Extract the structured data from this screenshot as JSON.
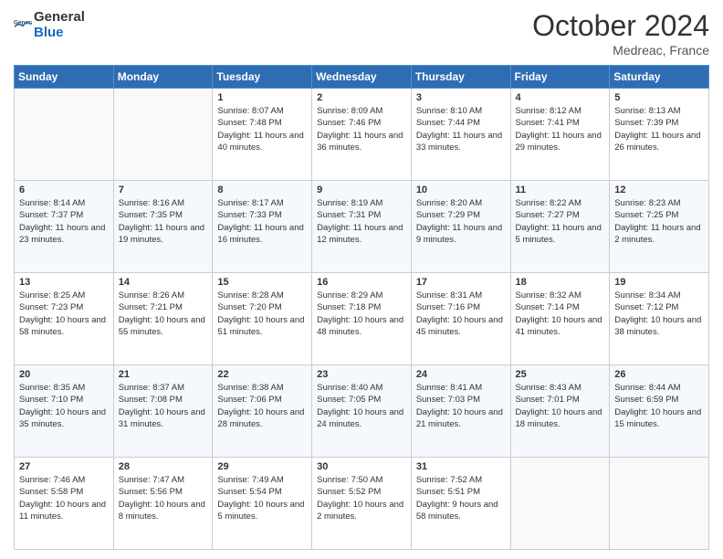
{
  "header": {
    "logo_general": "General",
    "logo_blue": "Blue",
    "title": "October 2024",
    "location": "Medreac, France"
  },
  "columns": [
    "Sunday",
    "Monday",
    "Tuesday",
    "Wednesday",
    "Thursday",
    "Friday",
    "Saturday"
  ],
  "weeks": [
    [
      {
        "day": "",
        "info": ""
      },
      {
        "day": "",
        "info": ""
      },
      {
        "day": "1",
        "info": "Sunrise: 8:07 AM\nSunset: 7:48 PM\nDaylight: 11 hours and 40 minutes."
      },
      {
        "day": "2",
        "info": "Sunrise: 8:09 AM\nSunset: 7:46 PM\nDaylight: 11 hours and 36 minutes."
      },
      {
        "day": "3",
        "info": "Sunrise: 8:10 AM\nSunset: 7:44 PM\nDaylight: 11 hours and 33 minutes."
      },
      {
        "day": "4",
        "info": "Sunrise: 8:12 AM\nSunset: 7:41 PM\nDaylight: 11 hours and 29 minutes."
      },
      {
        "day": "5",
        "info": "Sunrise: 8:13 AM\nSunset: 7:39 PM\nDaylight: 11 hours and 26 minutes."
      }
    ],
    [
      {
        "day": "6",
        "info": "Sunrise: 8:14 AM\nSunset: 7:37 PM\nDaylight: 11 hours and 23 minutes."
      },
      {
        "day": "7",
        "info": "Sunrise: 8:16 AM\nSunset: 7:35 PM\nDaylight: 11 hours and 19 minutes."
      },
      {
        "day": "8",
        "info": "Sunrise: 8:17 AM\nSunset: 7:33 PM\nDaylight: 11 hours and 16 minutes."
      },
      {
        "day": "9",
        "info": "Sunrise: 8:19 AM\nSunset: 7:31 PM\nDaylight: 11 hours and 12 minutes."
      },
      {
        "day": "10",
        "info": "Sunrise: 8:20 AM\nSunset: 7:29 PM\nDaylight: 11 hours and 9 minutes."
      },
      {
        "day": "11",
        "info": "Sunrise: 8:22 AM\nSunset: 7:27 PM\nDaylight: 11 hours and 5 minutes."
      },
      {
        "day": "12",
        "info": "Sunrise: 8:23 AM\nSunset: 7:25 PM\nDaylight: 11 hours and 2 minutes."
      }
    ],
    [
      {
        "day": "13",
        "info": "Sunrise: 8:25 AM\nSunset: 7:23 PM\nDaylight: 10 hours and 58 minutes."
      },
      {
        "day": "14",
        "info": "Sunrise: 8:26 AM\nSunset: 7:21 PM\nDaylight: 10 hours and 55 minutes."
      },
      {
        "day": "15",
        "info": "Sunrise: 8:28 AM\nSunset: 7:20 PM\nDaylight: 10 hours and 51 minutes."
      },
      {
        "day": "16",
        "info": "Sunrise: 8:29 AM\nSunset: 7:18 PM\nDaylight: 10 hours and 48 minutes."
      },
      {
        "day": "17",
        "info": "Sunrise: 8:31 AM\nSunset: 7:16 PM\nDaylight: 10 hours and 45 minutes."
      },
      {
        "day": "18",
        "info": "Sunrise: 8:32 AM\nSunset: 7:14 PM\nDaylight: 10 hours and 41 minutes."
      },
      {
        "day": "19",
        "info": "Sunrise: 8:34 AM\nSunset: 7:12 PM\nDaylight: 10 hours and 38 minutes."
      }
    ],
    [
      {
        "day": "20",
        "info": "Sunrise: 8:35 AM\nSunset: 7:10 PM\nDaylight: 10 hours and 35 minutes."
      },
      {
        "day": "21",
        "info": "Sunrise: 8:37 AM\nSunset: 7:08 PM\nDaylight: 10 hours and 31 minutes."
      },
      {
        "day": "22",
        "info": "Sunrise: 8:38 AM\nSunset: 7:06 PM\nDaylight: 10 hours and 28 minutes."
      },
      {
        "day": "23",
        "info": "Sunrise: 8:40 AM\nSunset: 7:05 PM\nDaylight: 10 hours and 24 minutes."
      },
      {
        "day": "24",
        "info": "Sunrise: 8:41 AM\nSunset: 7:03 PM\nDaylight: 10 hours and 21 minutes."
      },
      {
        "day": "25",
        "info": "Sunrise: 8:43 AM\nSunset: 7:01 PM\nDaylight: 10 hours and 18 minutes."
      },
      {
        "day": "26",
        "info": "Sunrise: 8:44 AM\nSunset: 6:59 PM\nDaylight: 10 hours and 15 minutes."
      }
    ],
    [
      {
        "day": "27",
        "info": "Sunrise: 7:46 AM\nSunset: 5:58 PM\nDaylight: 10 hours and 11 minutes."
      },
      {
        "day": "28",
        "info": "Sunrise: 7:47 AM\nSunset: 5:56 PM\nDaylight: 10 hours and 8 minutes."
      },
      {
        "day": "29",
        "info": "Sunrise: 7:49 AM\nSunset: 5:54 PM\nDaylight: 10 hours and 5 minutes."
      },
      {
        "day": "30",
        "info": "Sunrise: 7:50 AM\nSunset: 5:52 PM\nDaylight: 10 hours and 2 minutes."
      },
      {
        "day": "31",
        "info": "Sunrise: 7:52 AM\nSunset: 5:51 PM\nDaylight: 9 hours and 58 minutes."
      },
      {
        "day": "",
        "info": ""
      },
      {
        "day": "",
        "info": ""
      }
    ]
  ]
}
